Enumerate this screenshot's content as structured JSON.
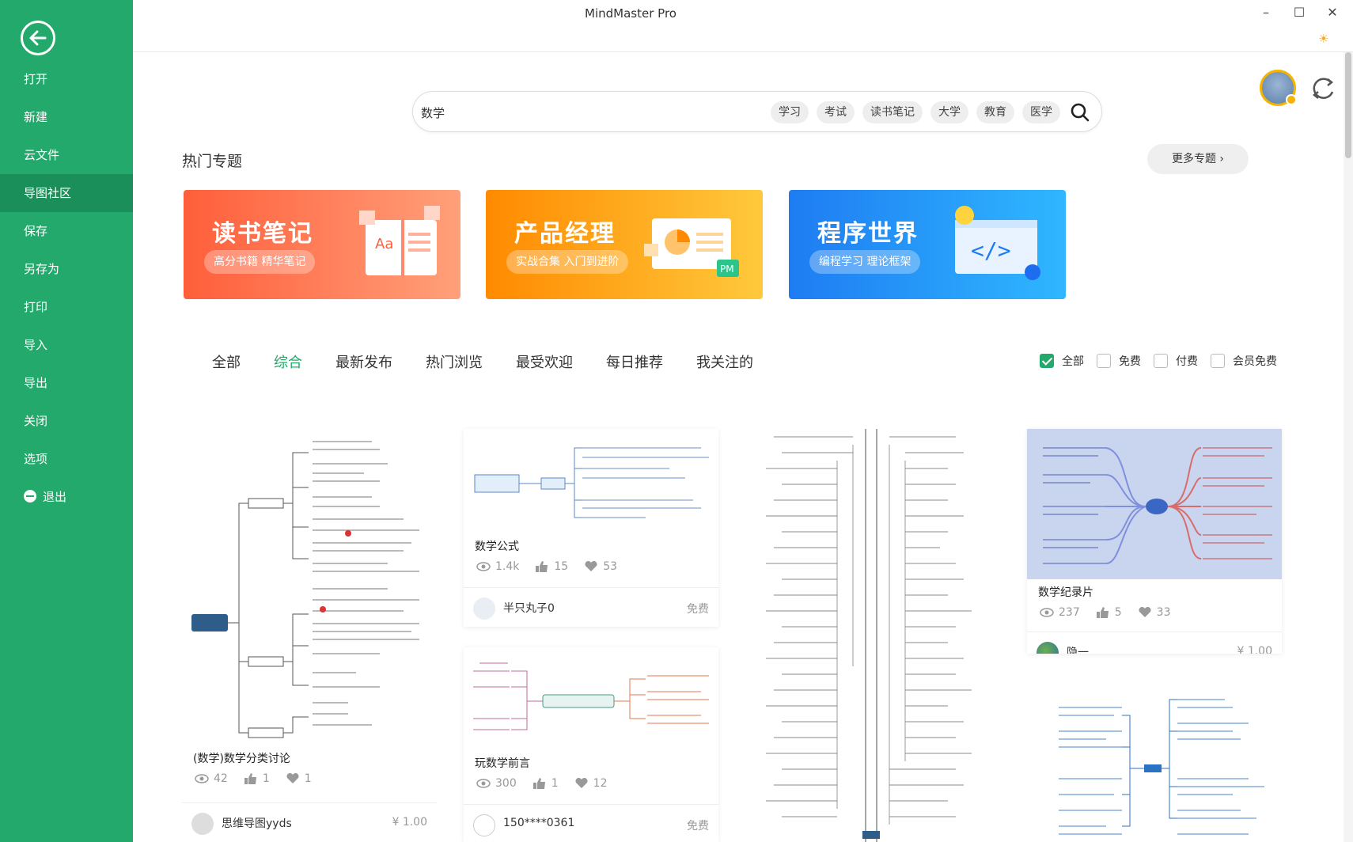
{
  "app": {
    "title": "MindMaster Pro"
  },
  "sidebar": {
    "items": [
      {
        "label": "打开"
      },
      {
        "label": "新建"
      },
      {
        "label": "云文件"
      },
      {
        "label": "导图社区"
      },
      {
        "label": "保存"
      },
      {
        "label": "另存为"
      },
      {
        "label": "打印"
      },
      {
        "label": "导入"
      },
      {
        "label": "导出"
      },
      {
        "label": "关闭"
      },
      {
        "label": "选项"
      },
      {
        "label": "退出"
      }
    ],
    "active_index": 3
  },
  "search": {
    "value": "数学",
    "tags": [
      "学习",
      "考试",
      "读书笔记",
      "大学",
      "教育",
      "医学"
    ]
  },
  "hot_topics": {
    "title": "热门专题",
    "more_label": "更多专题",
    "banners": [
      {
        "title": "读书笔记",
        "subtitle": "高分书籍 精华笔记"
      },
      {
        "title": "产品经理",
        "subtitle": "实战合集 入门到进阶"
      },
      {
        "title": "程序世界",
        "subtitle": "编程学习 理论框架"
      }
    ]
  },
  "tabs": [
    "全部",
    "综合",
    "最新发布",
    "热门浏览",
    "最受欢迎",
    "每日推荐",
    "我关注的"
  ],
  "active_tab": 1,
  "filters": [
    {
      "label": "全部",
      "checked": true
    },
    {
      "label": "免费",
      "checked": false
    },
    {
      "label": "付费",
      "checked": false
    },
    {
      "label": "会员免费",
      "checked": false
    }
  ],
  "cards": [
    {
      "title": "(数学)数学分类讨论",
      "views": "42",
      "likes": "1",
      "favs": "1",
      "author": "思维导图yyds",
      "price": "¥ 1.00"
    },
    {
      "title": "数学公式",
      "views": "1.4k",
      "likes": "15",
      "favs": "53",
      "author": "半只丸子0",
      "price": "免费"
    },
    {
      "title": "玩数学前言",
      "views": "300",
      "likes": "1",
      "favs": "12",
      "author": "150****0361",
      "price": "免费"
    },
    {
      "title": "数学纪录片",
      "views": "237",
      "likes": "5",
      "favs": "33",
      "author": "隐一",
      "price": "¥ 1.00"
    }
  ],
  "colors": {
    "brand": "#23a96b",
    "active_nav": "#1b8f59"
  }
}
